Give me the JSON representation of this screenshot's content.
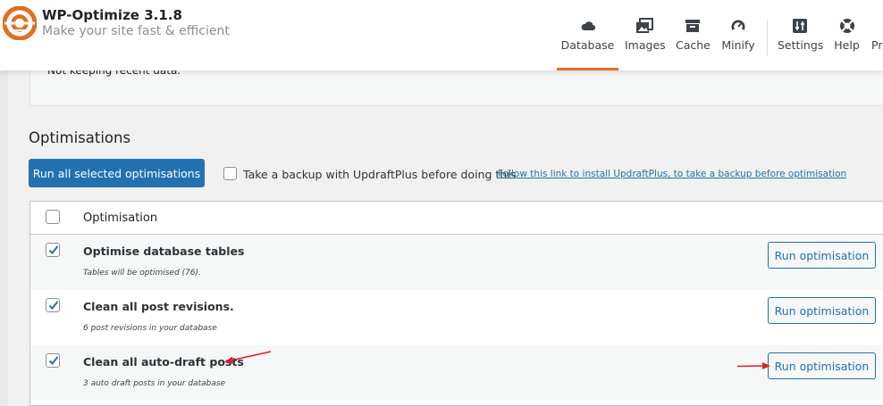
{
  "app": {
    "title": "WP-Optimize 3.1.8",
    "subtitle": "Make your site fast & efficient"
  },
  "nav": {
    "items": [
      {
        "label": "Database",
        "icon": "cloud-icon",
        "active": true
      },
      {
        "label": "Images",
        "icon": "images-icon",
        "active": false
      },
      {
        "label": "Cache",
        "icon": "archive-icon",
        "active": false
      },
      {
        "label": "Minify",
        "icon": "gauge-icon",
        "active": false
      },
      {
        "label": "Settings",
        "icon": "sliders-icon",
        "active": false
      },
      {
        "label": "Help",
        "icon": "lifebuoy-icon",
        "active": false
      },
      {
        "label": "Pr",
        "icon": "premium-icon",
        "active": false
      }
    ]
  },
  "info_panel": {
    "text": "Not keeping recent data."
  },
  "optimisations": {
    "title": "Optimisations",
    "run_all_label": "Run all selected optimisations",
    "backup_label": "Take a backup with UpdraftPlus before doing this",
    "backup_link": "Follow this link to install UpdraftPlus, to take a backup before optimisation",
    "backup_checked": false
  },
  "table": {
    "header_label": "Optimisation",
    "header_checked": false,
    "rows": [
      {
        "name": "Optimise database tables",
        "desc": "Tables will be optimised (76).",
        "checked": true,
        "button": "Run optimisation"
      },
      {
        "name": "Clean all post revisions.",
        "desc": "6 post revisions in your database",
        "checked": true,
        "button": "Run optimisation"
      },
      {
        "name": "Clean all auto-draft posts",
        "desc": "3 auto draft posts in your database",
        "checked": true,
        "button": "Run optimisation"
      }
    ]
  },
  "colors": {
    "accent": "#e26e21",
    "primary": "#2271b1",
    "annotation": "#e02020"
  }
}
